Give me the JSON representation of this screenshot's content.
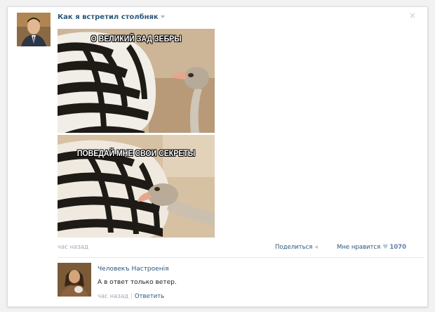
{
  "post": {
    "title": "Как я встретил столбняк",
    "close_glyph": "×",
    "meme": {
      "caption_top": "О ВЕЛИКИЙ ЗАД ЗЕБРЫ",
      "caption_bottom": "ПОВЕДАЙ МНЕ СВОИ СЕКРЕТЫ"
    },
    "time": "час назад",
    "share_label": "Поделиться",
    "like_label": "Мне нравится",
    "like_count": "1070"
  },
  "comment": {
    "author": "Человекъ Настроенія",
    "text": "А в ответ только ветер.",
    "time": "час назад",
    "separator": "|",
    "reply_label": "Ответить"
  },
  "colors": {
    "link": "#2b587a",
    "muted": "#a0aab5",
    "background": "#f2f2f2"
  }
}
